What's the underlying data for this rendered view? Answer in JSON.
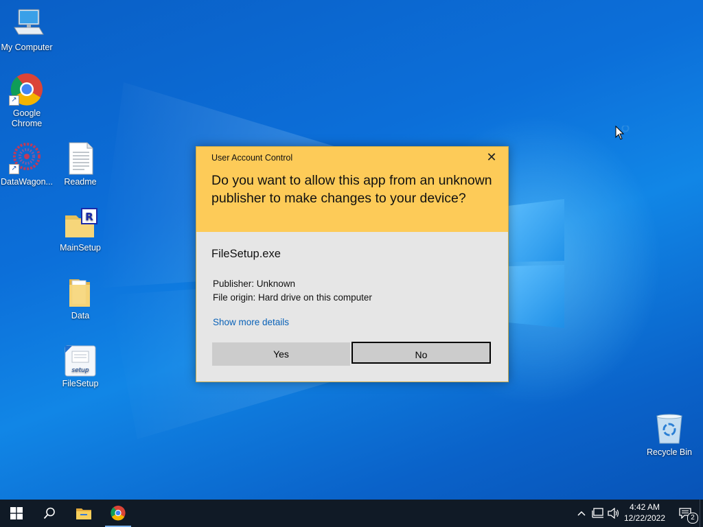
{
  "desktop": {
    "icons": [
      {
        "label": "My Computer",
        "icon": "computer-icon"
      },
      {
        "label": "Google Chrome",
        "icon": "chrome-icon"
      },
      {
        "label": "DataWagon...",
        "icon": "datawagon-icon"
      },
      {
        "label": "Readme",
        "icon": "text-document-icon"
      },
      {
        "label": "MainSetup",
        "icon": "setup-folder-icon"
      },
      {
        "label": "Data",
        "icon": "folder-icon"
      },
      {
        "label": "FileSetup",
        "icon": "setup-icon"
      },
      {
        "label": "Recycle Bin",
        "icon": "recycle-bin-icon"
      }
    ]
  },
  "dialog": {
    "title": "User Account Control",
    "question": "Do you want to allow this app from an unknown publisher to make changes to your device?",
    "app_name": "FileSetup.exe",
    "publisher": "Publisher: Unknown",
    "origin": "File origin: Hard drive on this computer",
    "more_details": "Show more details",
    "yes_label": "Yes",
    "no_label": "No",
    "close_glyph": "✕",
    "header_color": "#fdcb58"
  },
  "taskbar": {
    "time": "4:42 AM",
    "date": "12/22/2022",
    "notification_count": "2",
    "background": "#101a26"
  }
}
